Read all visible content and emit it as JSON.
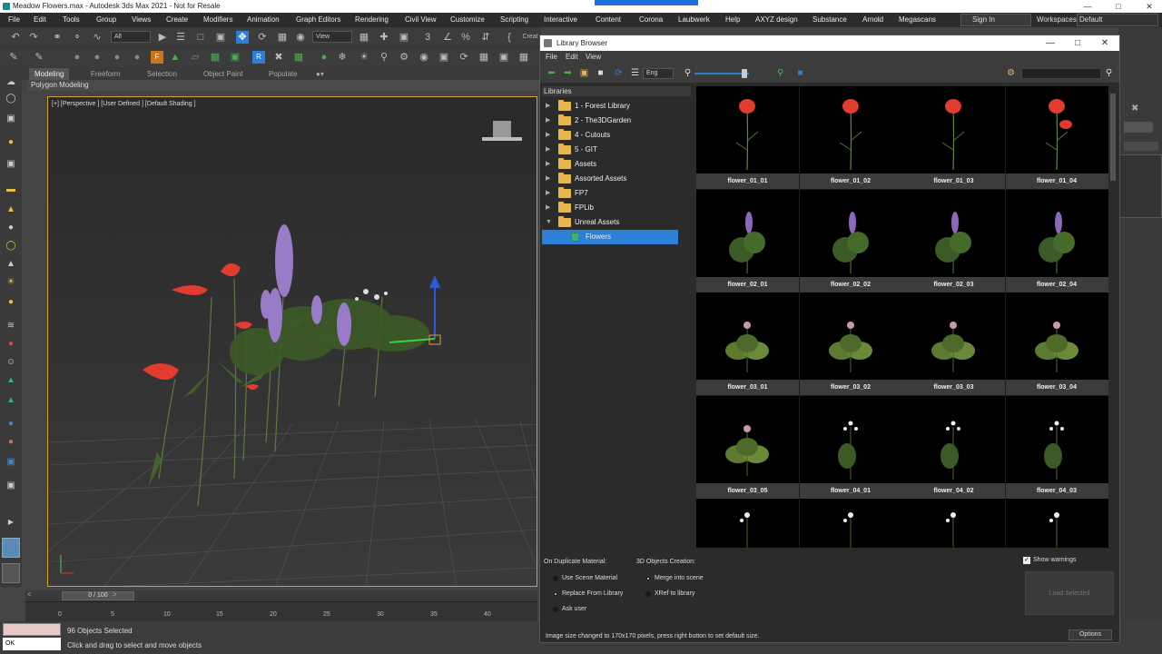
{
  "window": {
    "title": "Meadow Flowers.max - Autodesk 3ds Max 2021 - Not for Resale",
    "minimize_icon": "minimize-icon",
    "maximize_icon": "maximize-icon",
    "close_icon": "close-icon"
  },
  "menu": [
    "File",
    "Edit",
    "Tools",
    "Group",
    "Views",
    "Create",
    "Modifiers",
    "Animation",
    "Graph Editors",
    "Rendering",
    "Civil View",
    "Customize",
    "Scripting",
    "Interactive",
    "Content",
    "Corona",
    "Laubwerk",
    "Help",
    "AXYZ design",
    "Substance",
    "Arnold",
    "Megascans"
  ],
  "signin": "Sign In",
  "workspaces_label": "Workspaces:",
  "workspace": "Default",
  "toolbar": {
    "selection_filter": "All",
    "ref_coord": "View",
    "create_label": "Creat"
  },
  "ribbon_tabs": [
    "Modeling",
    "Freeform",
    "Selection",
    "Object Paint",
    "Populate"
  ],
  "ribbon_sub": "Polygon Modeling",
  "viewport": {
    "label": "[+] [Perspective ] [User Defined ] [Default Shading ]"
  },
  "timeline": {
    "frame": "0 / 100",
    "ticks": [
      "0",
      "5",
      "10",
      "15",
      "20",
      "25",
      "30",
      "35",
      "40"
    ]
  },
  "status": {
    "selected": "96 Objects Selected",
    "hint": "Click and drag to select and move objects",
    "script_value": "OK"
  },
  "library": {
    "title": "Library Browser",
    "menu": [
      "File",
      "Edit",
      "View"
    ],
    "language": "Eng",
    "libraries_label": "Libraries",
    "tree": [
      {
        "label": "1 - Forest Library"
      },
      {
        "label": "2 - The3DGarden"
      },
      {
        "label": "4 - Cutouts"
      },
      {
        "label": "5 - GIT"
      },
      {
        "label": "Assets"
      },
      {
        "label": "Assorted Assets"
      },
      {
        "label": "FP7"
      },
      {
        "label": "FPLib"
      },
      {
        "label": "Unreal Assets"
      }
    ],
    "selected_child": "Flowers",
    "assets": [
      "flower_01_01",
      "flower_01_02",
      "flower_01_03",
      "flower_01_04",
      "flower_02_01",
      "flower_02_02",
      "flower_02_03",
      "flower_02_04",
      "flower_03_01",
      "flower_03_02",
      "flower_03_03",
      "flower_03_04",
      "flower_03_05",
      "flower_04_01",
      "flower_04_02",
      "flower_04_03"
    ],
    "options": {
      "dup_label": "On Duplicate Material:",
      "dup_opts": [
        "Use Scene Material",
        "Replace From Library",
        "Ask user"
      ],
      "creation_label": "3D Objects Creation:",
      "creation_opts": [
        "Merge into scene",
        "XRef to library"
      ],
      "show_warnings": "Show warnings",
      "load_selected": "Load Selected",
      "options_btn": "Options",
      "info": "Image size changed to 170x170 pixels, press right button to set default size."
    }
  }
}
